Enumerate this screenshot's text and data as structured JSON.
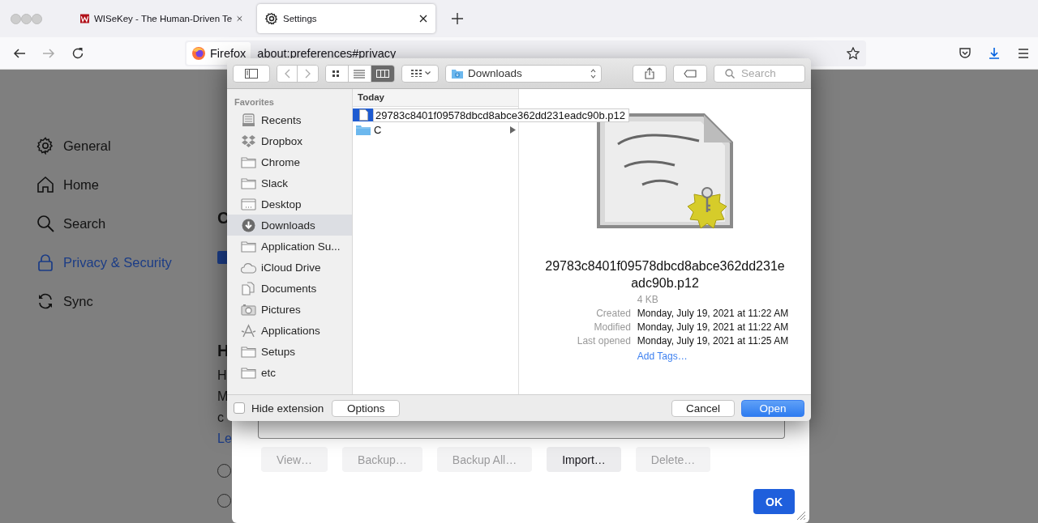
{
  "browser": {
    "tabs": [
      {
        "title": "WISeKey - The Human-Driven Te",
        "kind": "site",
        "selected": false
      },
      {
        "title": "Settings",
        "kind": "settings",
        "selected": true
      }
    ],
    "identity": "Firefox",
    "url": "about:preferences#privacy"
  },
  "settings_sidebar": [
    {
      "label": "General",
      "kind": "general",
      "selected": false
    },
    {
      "label": "Home",
      "kind": "home",
      "selected": false
    },
    {
      "label": "Search",
      "kind": "search",
      "selected": false
    },
    {
      "label": "Privacy & Security",
      "kind": "privacy",
      "selected": true
    },
    {
      "label": "Sync",
      "kind": "sync",
      "selected": false
    }
  ],
  "settings_page": {
    "heading_1": "C",
    "checkbox_checked": true,
    "heading_2": "H",
    "lines": [
      "H",
      "M",
      "c"
    ],
    "link": "Le",
    "radios": [
      {
        "selected": false
      },
      {
        "selected": false
      }
    ]
  },
  "certificate_dialog": {
    "buttons": [
      {
        "label": "View…",
        "disabled": true
      },
      {
        "label": "Backup…",
        "disabled": true
      },
      {
        "label": "Backup All…",
        "disabled": true
      },
      {
        "label": "Import…",
        "disabled": false
      },
      {
        "label": "Delete…",
        "disabled": true
      }
    ],
    "ok": "OK"
  },
  "file_dialog": {
    "location": "Downloads",
    "search_placeholder": "Search",
    "view_modes": [
      {
        "kind": "icons",
        "selected": false
      },
      {
        "kind": "list",
        "selected": false
      },
      {
        "kind": "columns",
        "selected": true
      }
    ],
    "sidebar_heading": "Favorites",
    "sidebar": [
      {
        "label": "Recents",
        "kind": "recents",
        "selected": false
      },
      {
        "label": "Dropbox",
        "kind": "dropbox",
        "selected": false
      },
      {
        "label": "Chrome",
        "kind": "folder",
        "selected": false
      },
      {
        "label": "Slack",
        "kind": "folder",
        "selected": false
      },
      {
        "label": "Desktop",
        "kind": "desktop",
        "selected": false
      },
      {
        "label": "Downloads",
        "kind": "downloads",
        "selected": true
      },
      {
        "label": "Application Su...",
        "kind": "folder",
        "selected": false
      },
      {
        "label": "iCloud Drive",
        "kind": "cloud",
        "selected": false
      },
      {
        "label": "Documents",
        "kind": "documents",
        "selected": false
      },
      {
        "label": "Pictures",
        "kind": "pictures",
        "selected": false
      },
      {
        "label": "Applications",
        "kind": "applications",
        "selected": false
      },
      {
        "label": "Setups",
        "kind": "folder",
        "selected": false
      },
      {
        "label": "etc",
        "kind": "folder",
        "selected": false
      }
    ],
    "column_heading": "Today",
    "entries": [
      {
        "name": "29783c8401f09578dbcd8abce362dd231eadc90b.p12",
        "kind": "file",
        "selected": true
      },
      {
        "name": "C",
        "kind": "folder",
        "selected": false
      }
    ],
    "preview": {
      "name_lines": [
        "29783c8401f09578dbcd8abce362dd231e",
        "adc90b.p12"
      ],
      "size": "4 KB",
      "details": [
        {
          "label": "Created",
          "value": "Monday, July 19, 2021 at 11:22 AM"
        },
        {
          "label": "Modified",
          "value": "Monday, July 19, 2021 at 11:22 AM"
        },
        {
          "label": "Last opened",
          "value": "Monday, July 19, 2021 at 11:25 AM"
        }
      ],
      "add_tags": "Add Tags…"
    },
    "hide_extension": false,
    "hide_extension_label": "Hide extension",
    "options": "Options",
    "cancel": "Cancel",
    "open": "Open"
  }
}
